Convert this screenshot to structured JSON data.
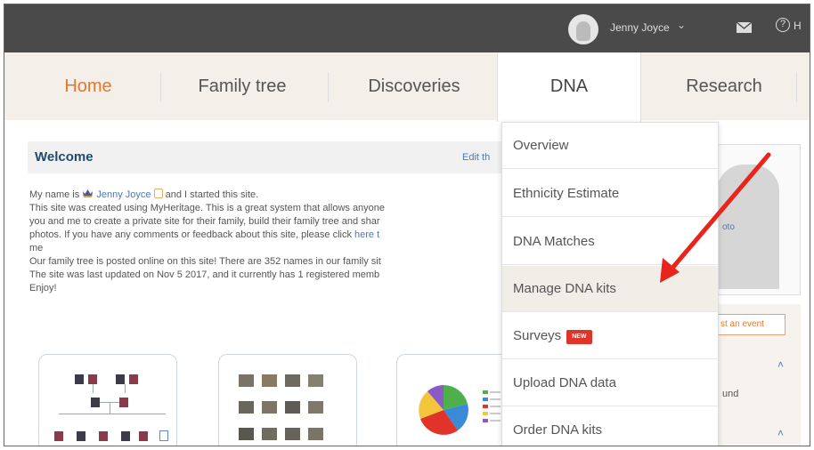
{
  "user": {
    "name": "Jenny Joyce",
    "help_label": "H"
  },
  "nav": {
    "items": [
      {
        "label": "Home"
      },
      {
        "label": "Family tree"
      },
      {
        "label": "Discoveries"
      },
      {
        "label": "DNA"
      },
      {
        "label": "Research"
      }
    ]
  },
  "welcome": {
    "title": "Welcome",
    "edit_link": "Edit th",
    "line1_pre": "My name is ",
    "line1_name": "Jenny Joyce",
    "line1_post": " and I started this site.",
    "line2": "This site was created using MyHeritage. This is a great system that allows anyone",
    "line3": "you and me to create a private site for their family, build their family tree and shar",
    "line4_pre": "photos. If you have any comments or feedback about this site, please click ",
    "line4_link": "here t",
    "line5": "me",
    "line6": "Our family tree is posted online on this site! There are 352 names in our family sit",
    "line7": "The site was last updated on Nov 5 2017, and it currently has 1 registered memb",
    "line8": "Enjoy!"
  },
  "sidebar": {
    "photo_text": "oto",
    "event_button": "st an event",
    "text2": "und"
  },
  "dropdown": {
    "items": [
      {
        "label": "Overview"
      },
      {
        "label": "Ethnicity Estimate"
      },
      {
        "label": "DNA Matches"
      },
      {
        "label": "Manage DNA kits"
      },
      {
        "label": "Surveys",
        "badge": "NEW"
      },
      {
        "label": "Upload DNA data"
      },
      {
        "label": "Order DNA kits"
      }
    ]
  },
  "colors": {
    "accent": "#e07a2e",
    "arrow": "#e8241c",
    "topbar": "#4a4a4a",
    "link": "#4a7ab5"
  }
}
